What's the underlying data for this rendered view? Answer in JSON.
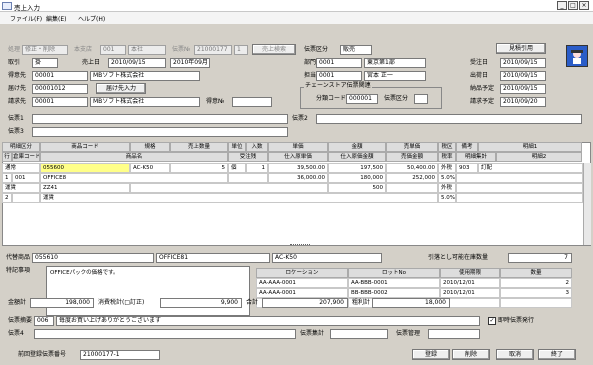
{
  "window": {
    "title": "売上入力",
    "min": "_",
    "max": "□",
    "close": "×"
  },
  "menu": [
    "ファイル(F)",
    "編集(E)",
    "ヘルプ(H)"
  ],
  "top": {
    "mode_label": "処理",
    "mode_value": "修正・削除",
    "branch_label": "本支店",
    "branch_code": "001",
    "branch_name": "本社",
    "slip_label": "伝票№",
    "slip_no": "21000177",
    "slip_sub": "1",
    "sales_search": "売上検索",
    "slip_kind_label": "伝票区分",
    "slip_kind": "販売",
    "estimate_btn": "見積引用"
  },
  "row1": {
    "trade_label": "取引",
    "trade": "掛",
    "sales_date_label": "売上日",
    "sales_date": "2010/09/15",
    "sales_month": "2010年09月",
    "dept_label": "部門",
    "dept_code": "0001",
    "dept_name": "東京第1部",
    "order_date_label": "受注日",
    "order_date": "2010/09/15"
  },
  "row2": {
    "client_label": "得意先",
    "client_code": "00001",
    "client_name": "MBソフト株式会社",
    "staff_label": "担当",
    "staff_code": "0001",
    "staff_name": "宮本 正一",
    "ship_date_label": "出荷日",
    "ship_date": "2010/09/15"
  },
  "row3": {
    "dest_label": "届け先",
    "dest_code": "00001012",
    "dest_btn": "届け先入力",
    "chain_label": "チェーンストア伝票関連",
    "delivery_label": "納品予定",
    "delivery_date": "2010/09/15"
  },
  "row4": {
    "bill_label": "請求先",
    "bill_code": "00001",
    "bill_name": "MBソフト株式会社",
    "client_no_label": "得意№",
    "cat_label": "分類コード",
    "cat_code": "000001",
    "slipcat_label": "伝票区分",
    "bill_plan_label": "請求予定",
    "bill_plan": "2010/09/20"
  },
  "slips": {
    "s1": "伝票1",
    "s2": "伝票2",
    "s3": "伝票3"
  },
  "grid_head1": [
    "明細区分",
    "商品コード",
    "規格",
    "売上数量",
    "単位",
    "入数",
    "単価",
    "金額",
    "売単価",
    "税区",
    "備考",
    "明細1"
  ],
  "grid_head2": [
    "行",
    "倉庫コード",
    "商品名",
    "受注残",
    "仕入原単価",
    "仕入原価金額",
    "売価金額",
    "税率",
    "明細集計",
    "明細2"
  ],
  "rows": [
    {
      "kbn": "通常",
      "code": "055600",
      "spec": "AC-K50",
      "qty": "5",
      "unit": "個",
      "irisu": "1",
      "price": "39,500.00",
      "amount": "197,500",
      "sell": "50,400.00",
      "tax": "外税",
      "note": "903",
      "d1": "訂配"
    },
    {
      "line": "1",
      "wh": "001",
      "name": "OFFICE8",
      "cost": "36,000.00",
      "costamt": "180,000",
      "sellamt": "252,000",
      "rate": "5.0%"
    },
    {
      "kbn": "運賃",
      "code": "ZZ41",
      "amount": "500",
      "tax": "外税"
    },
    {
      "line": "2",
      "name": "運賃",
      "rate": "5.0%"
    }
  ],
  "sub": {
    "alt_label": "代替商品",
    "alt_code": "055610",
    "alt_name": "OFFICE81",
    "alt_spec": "AC-K50",
    "alloc_label": "引落とし可能在庫数量",
    "alloc_qty": "7",
    "note_label": "特記事項",
    "note_text": "OFFICEパックの価格です。",
    "loc_head": [
      "ロケーション",
      "ロットNo",
      "使用期限",
      "数量"
    ],
    "locs": [
      {
        "loc": "AA-AAA-0001",
        "lot": "AA-BBB-0001",
        "exp": "2010/12/01",
        "qty": "2"
      },
      {
        "loc": "AA-AAA-0001",
        "lot": "BB-BBB-0002",
        "exp": "2010/12/01",
        "qty": "3"
      }
    ]
  },
  "totals": {
    "amt_label": "金額計",
    "amt": "198,000",
    "tax_label": "消費税計(□訂正)",
    "tax": "9,900",
    "sum_label": "合計",
    "sum": "207,900",
    "profit_label": "粗利計",
    "profit": "18,000"
  },
  "foot": {
    "summary_label": "伝票摘要",
    "summary_code": "006",
    "summary_text": "毎度お買い上げありがとうございます",
    "instant_label": "即時伝票発行",
    "s4_label": "伝票4",
    "total_label": "伝票集計",
    "mgmt_label": "伝票管理"
  },
  "status": {
    "prev_label": "前回登録伝票番号",
    "prev_no": "21000177-1",
    "register": "登録",
    "delete": "削除",
    "cancel": "取消",
    "end": "終了"
  }
}
